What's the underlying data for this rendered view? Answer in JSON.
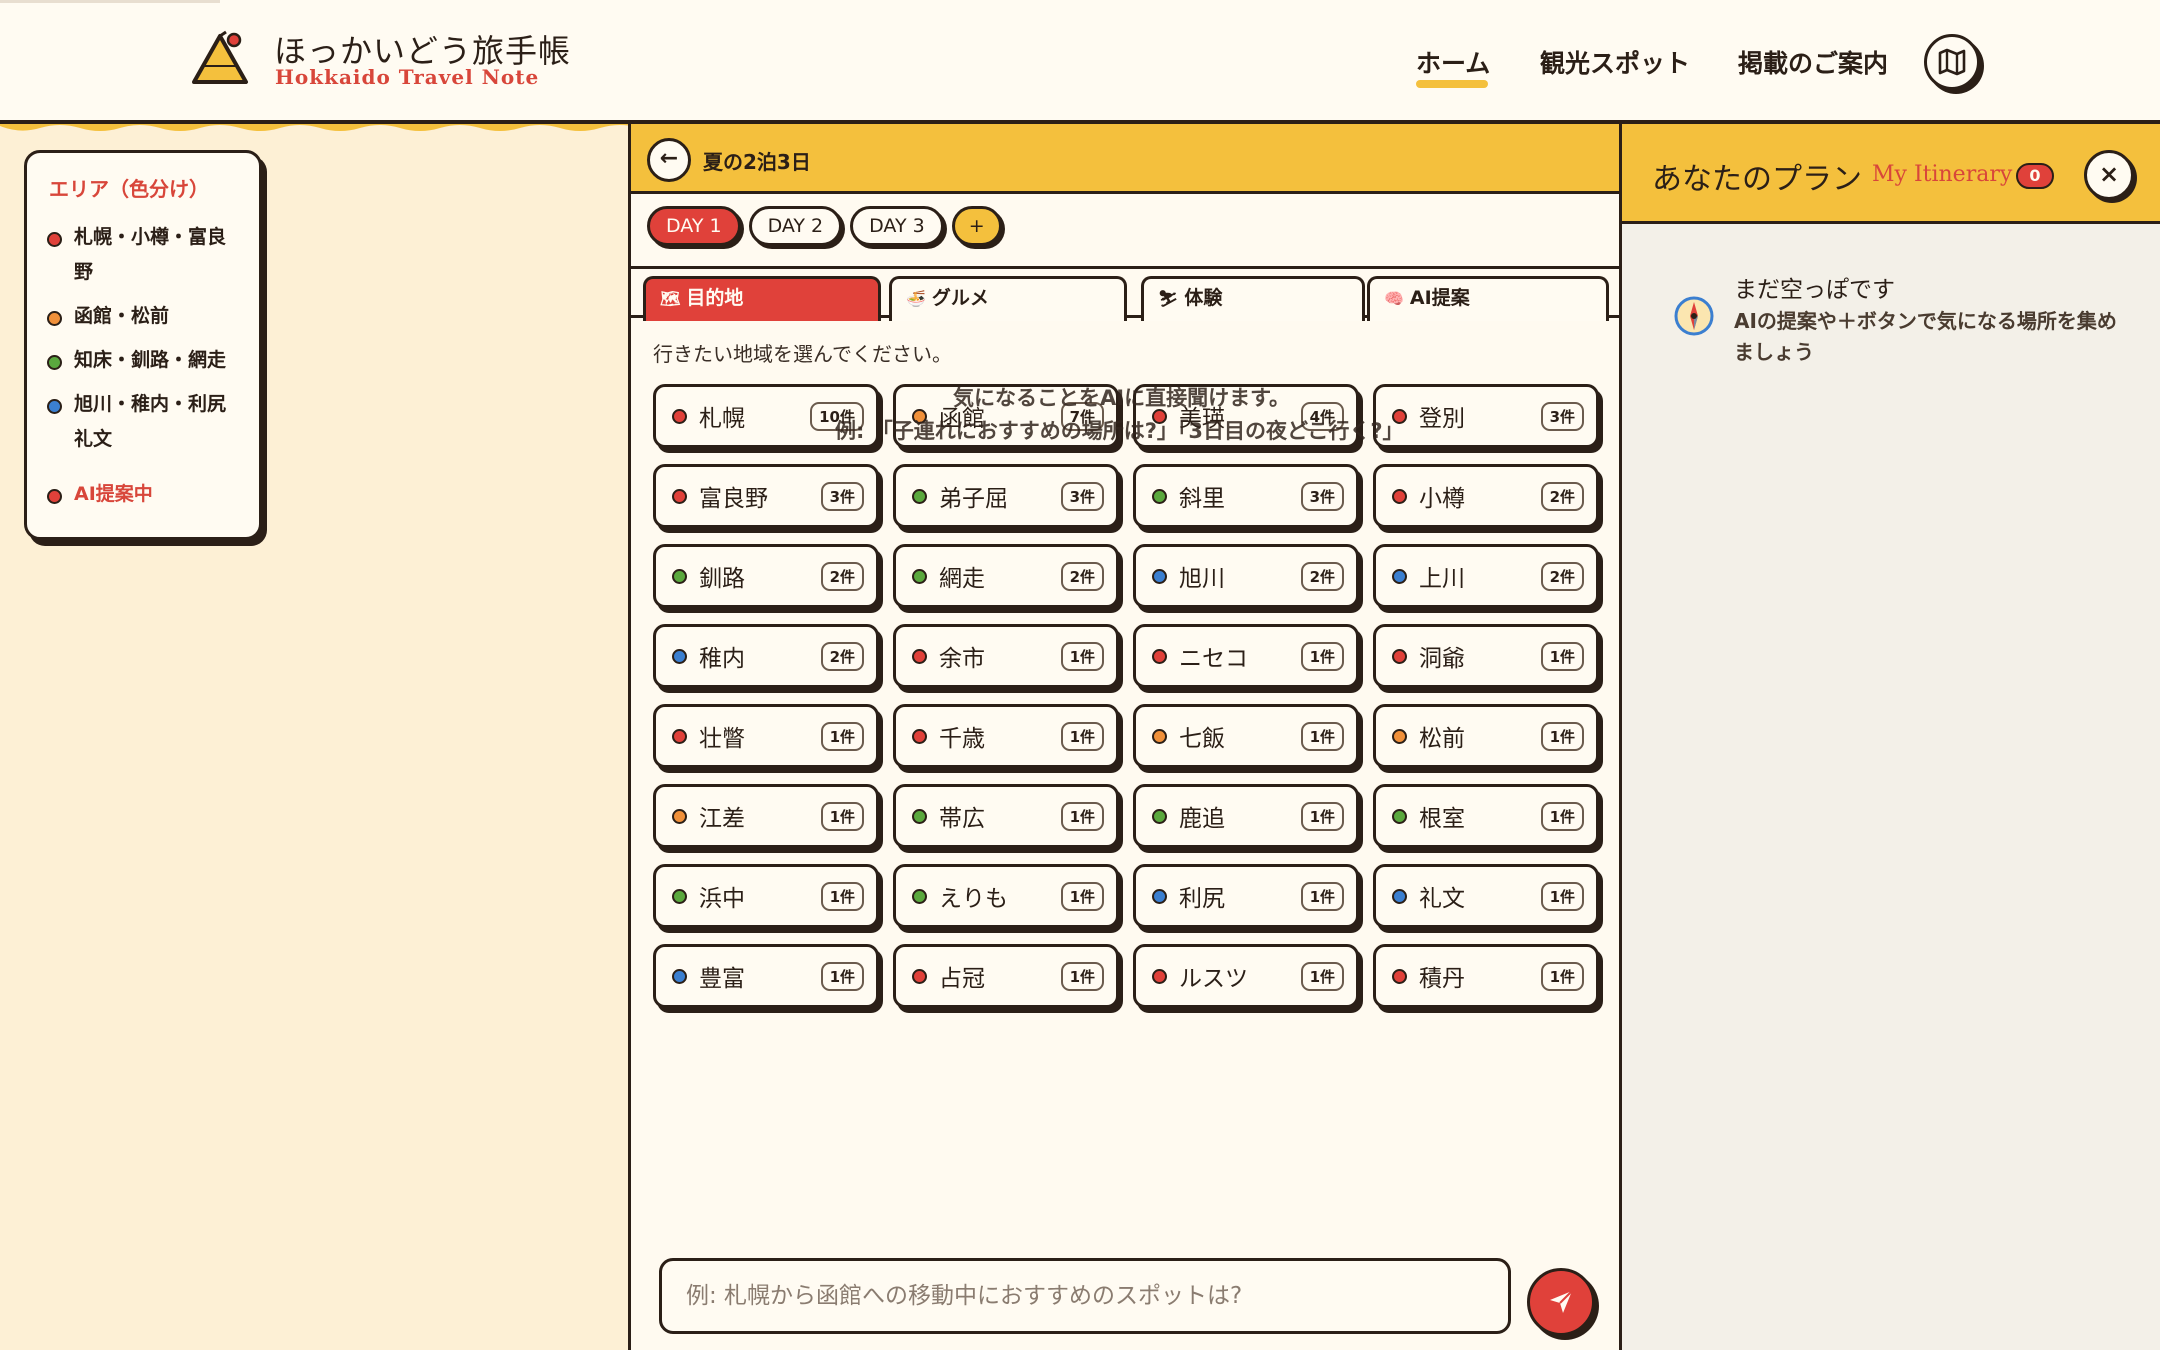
{
  "header": {
    "brand_jp": "ほっかいどう旅手帳",
    "brand_en": "Hokkaido Travel Note",
    "nav": [
      "ホーム",
      "観光スポット",
      "掲載のご案内"
    ],
    "active_nav": "ホーム",
    "map_icon": "map-icon"
  },
  "legend": {
    "title": "エリア（色分け）",
    "items": [
      {
        "label": "札幌・小樽・富良野",
        "color": "#e0413a"
      },
      {
        "label": "函館・松前",
        "color": "#f0903a"
      },
      {
        "label": "知床・釧路・網走",
        "color": "#5aa83e"
      },
      {
        "label": "旭川・稚内・利尻礼文",
        "color": "#3b7fd0"
      }
    ],
    "ai_label": "AI提案中"
  },
  "trip": {
    "back_icon": "arrow-left-icon",
    "back_glyph": "←",
    "title": "夏の2泊3日",
    "days": [
      "DAY 1",
      "DAY 2",
      "DAY 3"
    ],
    "active_day": "DAY 1",
    "add_day_label": "+"
  },
  "tabs": [
    {
      "label": "目的地",
      "icon": "map-icon",
      "glyph": "🗺"
    },
    {
      "label": "グルメ",
      "icon": "ramen-icon",
      "glyph": "🍜"
    },
    {
      "label": "体験",
      "icon": "ski-icon",
      "glyph": "⛷"
    },
    {
      "label": "AI提案",
      "icon": "brain-icon",
      "glyph": "🧠"
    }
  ],
  "active_tab": "目的地",
  "region_prompt": "行きたい地域を選んでください。",
  "ai_hint": {
    "line1": "気になることをAIに直接聞けます。",
    "line2": "例: 「子連れにおすすめの場所は?」「3日目の夜どこ行く?」"
  },
  "regions": [
    {
      "name": "札幌",
      "count": "10件",
      "area": "red"
    },
    {
      "name": "函館",
      "count": "7件",
      "area": "orange"
    },
    {
      "name": "美瑛",
      "count": "4件",
      "area": "red"
    },
    {
      "name": "登別",
      "count": "3件",
      "area": "red"
    },
    {
      "name": "富良野",
      "count": "3件",
      "area": "red"
    },
    {
      "name": "弟子屈",
      "count": "3件",
      "area": "green"
    },
    {
      "name": "斜里",
      "count": "3件",
      "area": "green"
    },
    {
      "name": "小樽",
      "count": "2件",
      "area": "red"
    },
    {
      "name": "釧路",
      "count": "2件",
      "area": "green"
    },
    {
      "name": "網走",
      "count": "2件",
      "area": "green"
    },
    {
      "name": "旭川",
      "count": "2件",
      "area": "blue"
    },
    {
      "name": "上川",
      "count": "2件",
      "area": "blue"
    },
    {
      "name": "稚内",
      "count": "2件",
      "area": "blue"
    },
    {
      "name": "余市",
      "count": "1件",
      "area": "red"
    },
    {
      "name": "ニセコ",
      "count": "1件",
      "area": "red"
    },
    {
      "name": "洞爺",
      "count": "1件",
      "area": "red"
    },
    {
      "name": "壮瞥",
      "count": "1件",
      "area": "red"
    },
    {
      "name": "千歳",
      "count": "1件",
      "area": "red"
    },
    {
      "name": "七飯",
      "count": "1件",
      "area": "orange"
    },
    {
      "name": "松前",
      "count": "1件",
      "area": "orange"
    },
    {
      "name": "江差",
      "count": "1件",
      "area": "orange"
    },
    {
      "name": "帯広",
      "count": "1件",
      "area": "green"
    },
    {
      "name": "鹿追",
      "count": "1件",
      "area": "green"
    },
    {
      "name": "根室",
      "count": "1件",
      "area": "green"
    },
    {
      "name": "浜中",
      "count": "1件",
      "area": "green"
    },
    {
      "name": "えりも",
      "count": "1件",
      "area": "green"
    },
    {
      "name": "利尻",
      "count": "1件",
      "area": "blue"
    },
    {
      "name": "礼文",
      "count": "1件",
      "area": "blue"
    },
    {
      "name": "豊富",
      "count": "1件",
      "area": "blue"
    },
    {
      "name": "占冠",
      "count": "1件",
      "area": "red"
    },
    {
      "name": "ルスツ",
      "count": "1件",
      "area": "red"
    },
    {
      "name": "積丹",
      "count": "1件",
      "area": "red"
    }
  ],
  "chat": {
    "placeholder": "例: 札幌から函館への移動中におすすめのスポットは?",
    "send_icon": "send-icon"
  },
  "itinerary": {
    "title": "あなたのプラン",
    "subtitle": "My Itinerary",
    "count": "0",
    "close_label": "×",
    "empty_icon": "compass-icon",
    "empty_title": "まだ空っぽです",
    "empty_desc": "AIの提案や＋ボタンで気になる場所を集めましょう"
  },
  "colors": {
    "red": "#e0413a",
    "orange": "#f0903a",
    "green": "#5aa83e",
    "blue": "#3b7fd0",
    "accent_yellow": "#f4c03d",
    "ink": "#2b1f17"
  }
}
